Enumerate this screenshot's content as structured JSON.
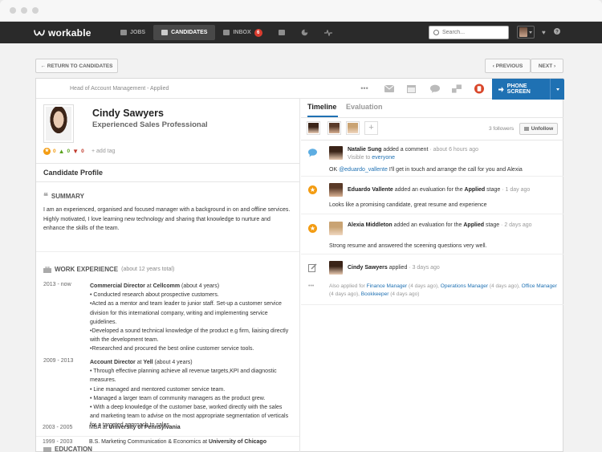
{
  "nav": {
    "logo": "workable",
    "items": [
      {
        "label": "JOBS"
      },
      {
        "label": "CANDIDATES"
      },
      {
        "label": "INBOX",
        "badge": "6"
      }
    ],
    "search_placeholder": "Search..."
  },
  "toolbar": {
    "back_label": "← RETURN TO CANDIDATES",
    "previous_label": "‹ PREVIOUS",
    "next_label": "NEXT ›"
  },
  "candidate": {
    "job_line": "Head of Account Management - Applied",
    "name": "Cindy Sawyers",
    "headline": "Experienced Sales Professional",
    "ratings": {
      "stars": "0",
      "up": "0",
      "down": "0"
    },
    "add_tag": "+ add tag",
    "phone_screen_label": "PHONE SCREEN"
  },
  "profile": {
    "title": "Candidate Profile",
    "summary_title": "SUMMARY",
    "summary_text": "I am an experienced, organised and focused manager with a background in on and offline services. Highly motivated, I love learning new technology and sharing that knowledge to nurture and enhance the skills of the team.",
    "experience_title": "WORK EXPERIENCE",
    "experience_sub": "(about 12 years total)",
    "jobs": [
      {
        "dates": "2013 - now",
        "role": "Commercial Director",
        "at": " at ",
        "company": "Cellcomm",
        "duration": " (about 4 years)",
        "bullets": [
          "• Conducted research about prospective customers.",
          "•Acted as a mentor and team leader to junior staff. Set-up a customer service division for this international company, writing and implementing service guidelines.",
          "•Developed a sound technical knowledge of the product e.g firm, liaising directly with the development team.",
          "•Researched and procured the best online customer service tools."
        ]
      },
      {
        "dates": "2009 - 2013",
        "role": "Account Director",
        "at": " at ",
        "company": "Yell",
        "duration": " (about 4 years)",
        "bullets": [
          "• Through effective planning achieve all revenue targets,KPI and diagnostic measures.",
          "• Line managed and mentored customer service team.",
          "• Managed a larger team of community managers as the product grew.",
          "• With a deep knowledge of the customer base, worked directly with the sales and marketing team to advise on the most appropriate segmentation of verticals for a targeted approach to sales."
        ]
      }
    ],
    "education_title": "EDUCATION",
    "education": [
      {
        "dates": "2003 - 2005",
        "degree": "MBA",
        "at": " at ",
        "school": "University of Pennsylvania"
      },
      {
        "dates": "1999 - 2003",
        "degree": "B.S. Marketing Communication & Economics",
        "at": " at ",
        "school": "University of Chicago"
      }
    ]
  },
  "timeline": {
    "tabs": [
      "Timeline",
      "Evaluation"
    ],
    "followers": "3 followers",
    "unfollow_label": "Unfollow",
    "entries": [
      {
        "actor": "Natalie Sung",
        "action": " added a comment",
        "time": " · about 6 hours ago",
        "visible_prefix": "Visible to ",
        "visible_link": "everyone",
        "mention": "@eduardo_vallente",
        "body_prefix": "OK ",
        "body": " I'll get in touch and arrange the call for you and Alexia"
      },
      {
        "actor": "Eduardo Vallente",
        "action": " added an evaluation for the ",
        "stage": "Applied",
        "stage_suffix": " stage",
        "time": " · 1 day ago",
        "body": "Looks like a promising candidate, great resume and experience"
      },
      {
        "actor": "Alexia Middleton",
        "action": " added an evaluation for the ",
        "stage": "Applied",
        "stage_suffix": " stage",
        "time": " · 2 days ago",
        "body": "Strong resume and answered the sceening questions very well."
      },
      {
        "actor": "Cindy Sawyers",
        "action": " applied",
        "time": " · 3 days ago"
      }
    ],
    "also_applied": {
      "prefix": "Also applied for ",
      "items": [
        {
          "job": "Finance Manager",
          "when": " (4 days ago), "
        },
        {
          "job": "Operations Manager",
          "when": " (4 days ago), "
        },
        {
          "job": "Office Manager",
          "when": " (4 days ago), "
        },
        {
          "job": "Bookkeeper",
          "when": " (4 days ago)"
        }
      ]
    }
  },
  "colors": {
    "accent": "#1f71b3",
    "topbar": "#2a2a2a",
    "star": "#f39c12",
    "badge": "#d93c2f"
  }
}
